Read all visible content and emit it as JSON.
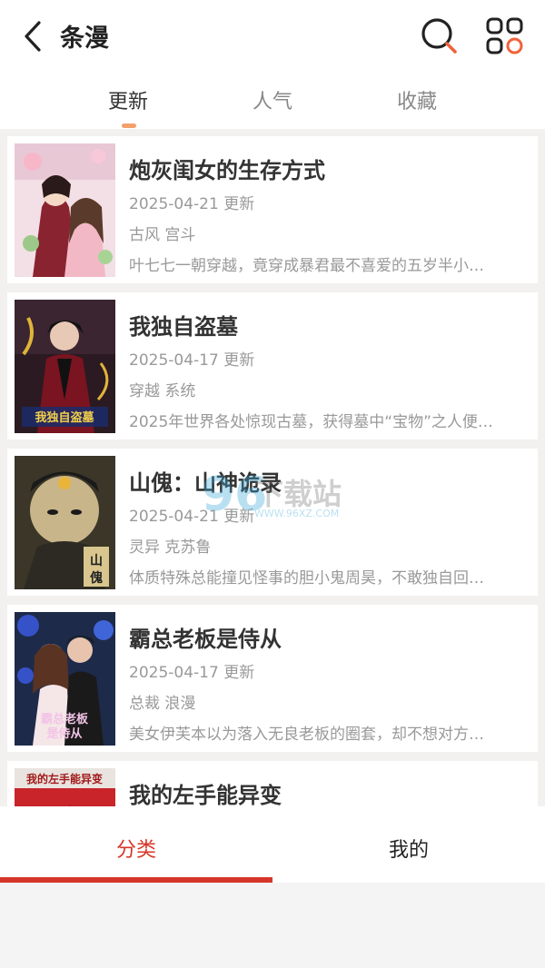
{
  "header": {
    "title": "条漫"
  },
  "tabs": [
    {
      "label": "更新",
      "active": true
    },
    {
      "label": "人气",
      "active": false
    },
    {
      "label": "收藏",
      "active": false
    }
  ],
  "comics": [
    {
      "title": "炮灰闺女的生存方式",
      "date": "2025-04-21 更新",
      "tags": "古风 宫斗",
      "description": "叶七七一朝穿越，竟穿成暴君最不喜爱的五岁半小…"
    },
    {
      "title": "我独自盗墓",
      "date": "2025-04-17 更新",
      "tags": "穿越 系统",
      "description": "2025年世界各处惊现古墓，获得墓中“宝物”之人便…"
    },
    {
      "title": "山傀：山神诡录",
      "date": "2025-04-21 更新",
      "tags": "灵异 克苏鲁",
      "description": "体质特殊总能撞见怪事的胆小鬼周昊，不敢独自回…"
    },
    {
      "title": "霸总老板是侍从",
      "date": "2025-04-17 更新",
      "tags": "总裁 浪漫",
      "description": "美女伊芙本以为落入无良老板的圈套，却不想对方…"
    },
    {
      "title": "我的左手能异变",
      "date": "",
      "tags": "",
      "description": ""
    }
  ],
  "watermark": {
    "number": "96",
    "text": "下载站",
    "url": "WWW.96XZ.COM"
  },
  "bottom_nav": {
    "items": [
      {
        "label": "分类",
        "active": true
      },
      {
        "label": "我的",
        "active": false
      }
    ]
  },
  "colors": {
    "accent_red": "#d6362a",
    "tab_indicator": "#f3a06a",
    "grid_icon_accent": "#f0623a"
  },
  "icons": {
    "back": "chevron-left-icon",
    "search": "search-icon",
    "grid": "grid-apps-icon"
  }
}
